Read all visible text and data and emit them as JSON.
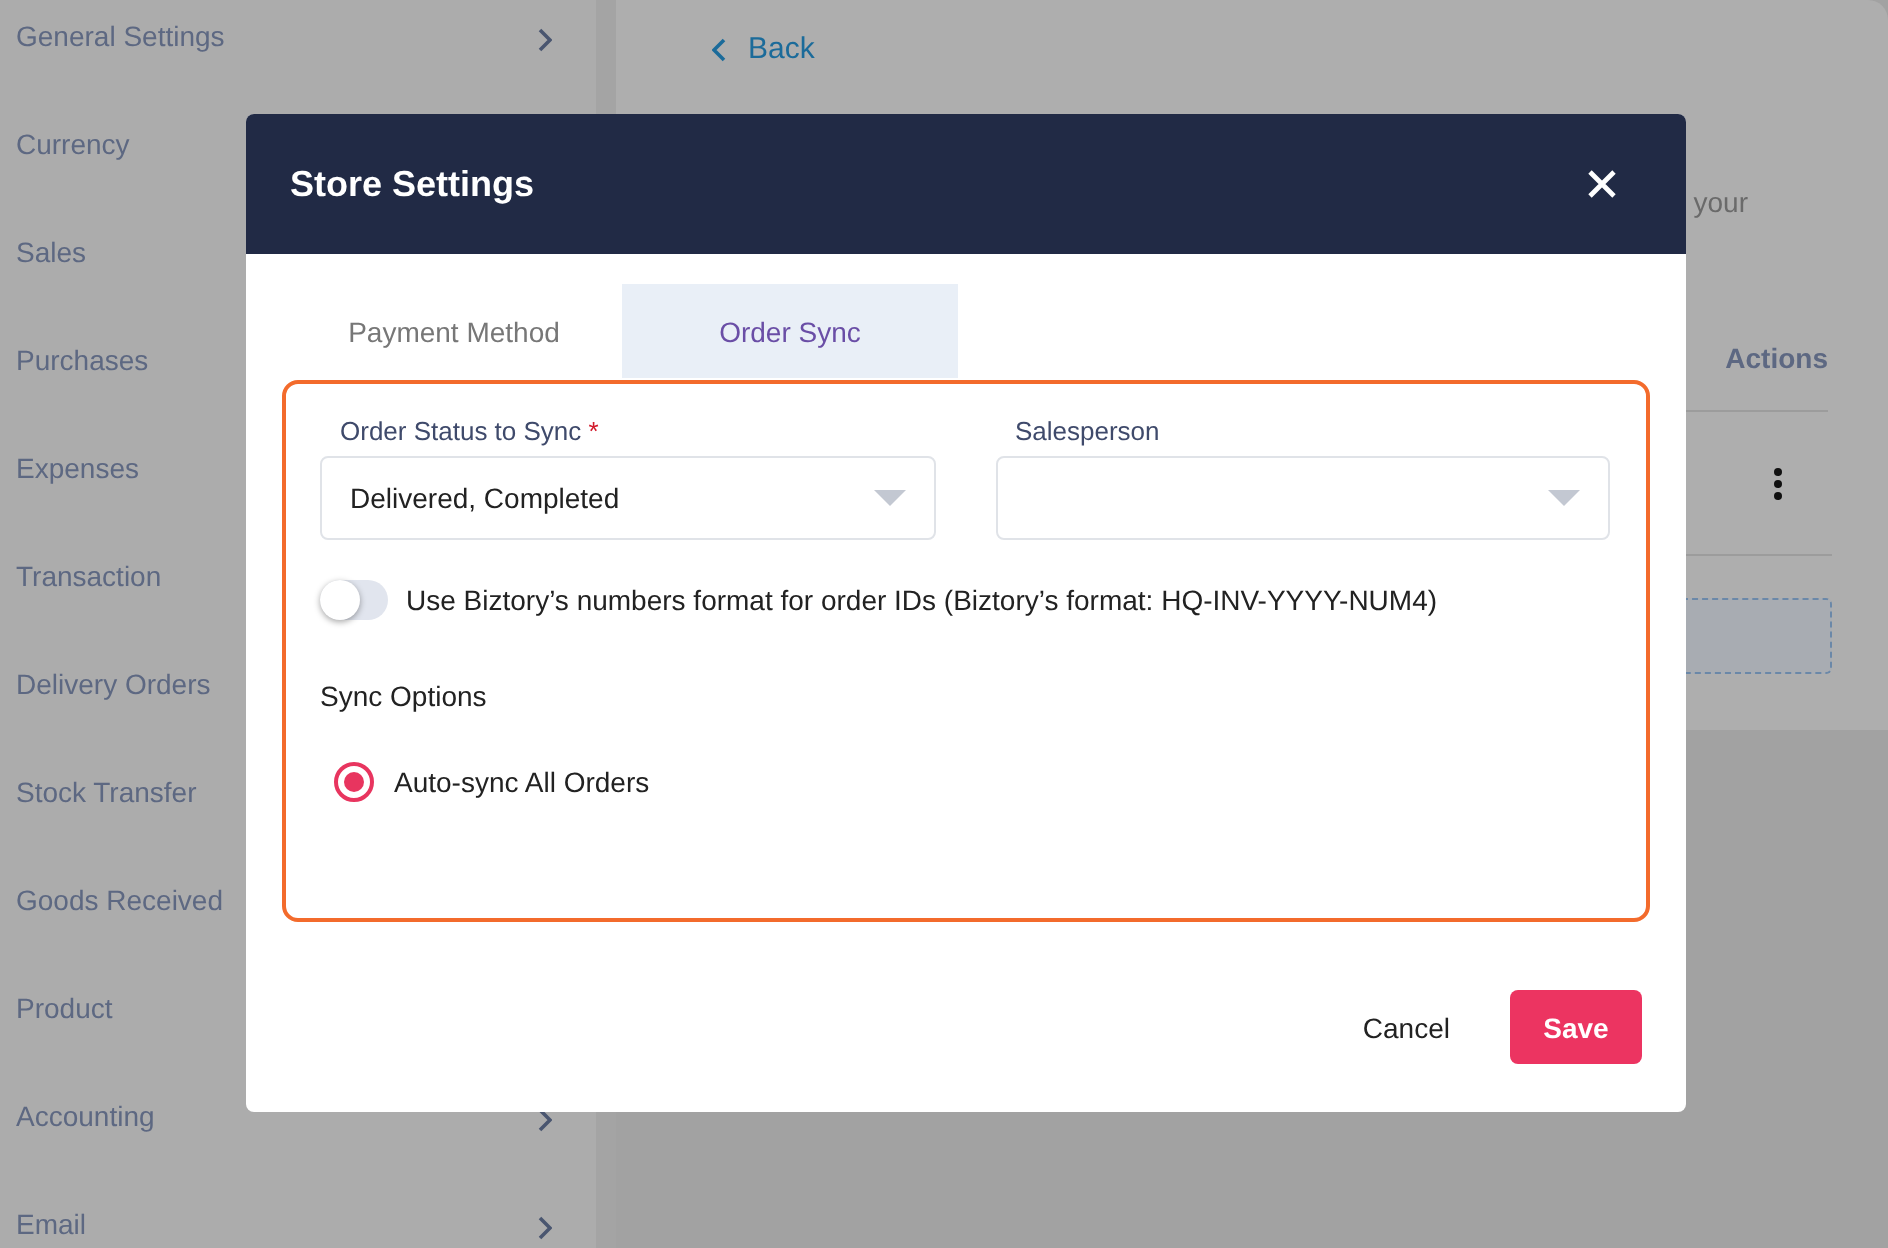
{
  "sidebar": {
    "items": [
      {
        "label": "General Settings",
        "has_children": true
      },
      {
        "label": "Currency"
      },
      {
        "label": "Sales"
      },
      {
        "label": "Purchases"
      },
      {
        "label": "Expenses"
      },
      {
        "label": "Transaction"
      },
      {
        "label": "Delivery Orders"
      },
      {
        "label": "Stock Transfer"
      },
      {
        "label": "Goods Received"
      },
      {
        "label": "Product"
      },
      {
        "label": "Accounting",
        "has_children": true
      },
      {
        "label": "Email",
        "has_children": true
      }
    ]
  },
  "page": {
    "back_link": "Back",
    "description_fragment": "your",
    "actions_header": "Actions"
  },
  "dialog": {
    "title": "Store Settings",
    "tabs": [
      {
        "label": "Payment Method",
        "selected": false
      },
      {
        "label": "Order Sync",
        "selected": true
      }
    ],
    "order_status": {
      "label": "Order Status to Sync",
      "required_mark": "*",
      "value": "Delivered, Completed"
    },
    "salesperson": {
      "label": "Salesperson"
    },
    "number_format_toggle": {
      "label": "Use Biztory’s numbers format for order IDs (Biztory’s format: HQ-INV-YYYY-NUM4)",
      "on": false
    },
    "sync_options": {
      "label": "Sync Options",
      "options": [
        {
          "label": "Auto-sync All Orders",
          "selected": true
        }
      ]
    },
    "buttons": {
      "cancel": "Cancel",
      "save": "Save"
    }
  }
}
